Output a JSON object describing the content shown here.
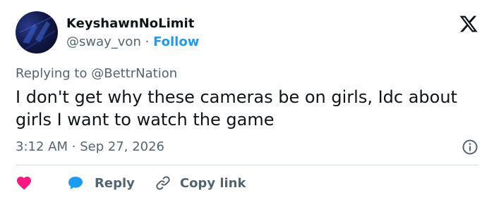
{
  "user": {
    "display_name": "KeyshawnNoLimit",
    "handle": "@sway_von",
    "separator": "·",
    "follow_label": "Follow"
  },
  "tweet": {
    "replying_prefix": "Replying to",
    "replying_to": "@BettrNation",
    "text": "I don't get why these cameras be on girls, Idc about girls I want to watch the game",
    "time": "3:12 AM",
    "date_separator": "·",
    "date": "Sep 27, 2026"
  },
  "actions": {
    "reply_label": "Reply",
    "copy_link_label": "Copy link"
  },
  "colors": {
    "accent": "#1d9bf0",
    "like": "#f91880",
    "text": "#0f1419",
    "muted": "#536471"
  },
  "icons": [
    "x-logo-icon",
    "info-icon",
    "heart-icon",
    "reply-bubble-icon",
    "link-icon"
  ]
}
